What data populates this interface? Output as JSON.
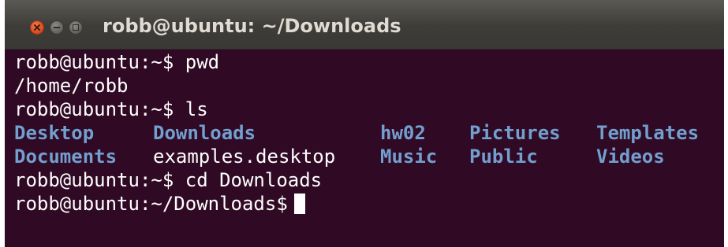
{
  "window": {
    "title": "robb@ubuntu: ~/Downloads"
  },
  "terminal": {
    "lines": [
      "robb@ubuntu:~$ pwd",
      "/home/robb",
      "robb@ubuntu:~$ ls",
      "robb@ubuntu:~$ cd Downloads",
      "robb@ubuntu:~/Downloads$"
    ],
    "ls_output": [
      {
        "name": "Desktop",
        "type": "dir"
      },
      {
        "name": "Downloads",
        "type": "dir"
      },
      {
        "name": "hw02",
        "type": "dir"
      },
      {
        "name": "Pictures",
        "type": "dir"
      },
      {
        "name": "Templates",
        "type": "dir"
      },
      {
        "name": "Documents",
        "type": "dir"
      },
      {
        "name": "examples.desktop",
        "type": "file"
      },
      {
        "name": "Music",
        "type": "dir"
      },
      {
        "name": "Public",
        "type": "dir"
      },
      {
        "name": "Videos",
        "type": "dir"
      }
    ],
    "colors": {
      "background": "#300a24",
      "text": "#ffffff",
      "directory": "#729fcf"
    }
  }
}
